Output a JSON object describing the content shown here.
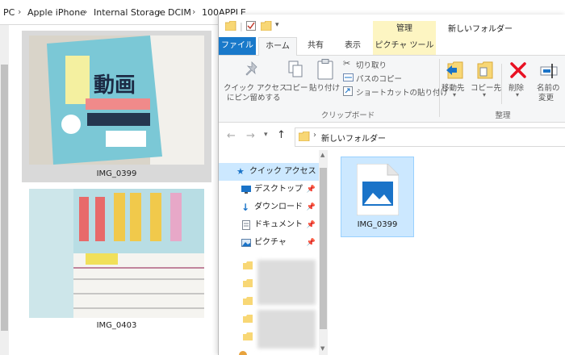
{
  "back_window": {
    "breadcrumb": [
      "PC",
      "Apple iPhone",
      "Internal Storage",
      "DCIM",
      "100APPLE"
    ],
    "photos": [
      {
        "name": "IMG_0399",
        "selected": true
      },
      {
        "name": "IMG_0403",
        "selected": false
      }
    ]
  },
  "front_window": {
    "title": "新しいフォルダー",
    "context_tab_group": "管理",
    "tabs": [
      "ファイル",
      "ホーム",
      "共有",
      "表示",
      "ピクチャ ツール"
    ],
    "ribbon": {
      "pin_quick_access": [
        "クイック アクセス",
        "にピン留めする"
      ],
      "copy": "コピー",
      "paste": "貼り付け",
      "cut": "切り取り",
      "copy_path": "パスのコピー",
      "paste_shortcut": "ショートカットの貼り付け",
      "clipboard_group": "クリップボード",
      "move_to": "移動先",
      "copy_to": "コピー先",
      "delete": "削除",
      "rename": [
        "名前の",
        "変更"
      ],
      "organize_group": "整理"
    },
    "address_path": "新しいフォルダー",
    "nav_items": [
      {
        "label": "クイック アクセス",
        "icon": "star-icon",
        "pinned": false
      },
      {
        "label": "デスクトップ",
        "icon": "desktop-icon",
        "pinned": true
      },
      {
        "label": "ダウンロード",
        "icon": "download-arrow-icon",
        "pinned": true
      },
      {
        "label": "ドキュメント",
        "icon": "document-icon",
        "pinned": true
      },
      {
        "label": "ピクチャ",
        "icon": "pictures-icon",
        "pinned": true
      }
    ],
    "files": [
      {
        "name": "IMG_0399",
        "icon": "image-file-icon"
      }
    ]
  },
  "colors": {
    "file_tab": "#1979ca",
    "selection": "#cce8ff",
    "context_tab": "#fdf5c2",
    "folder": "#f8d775",
    "delete_x": "#e81123",
    "accent_blue": "#1a73c8"
  }
}
